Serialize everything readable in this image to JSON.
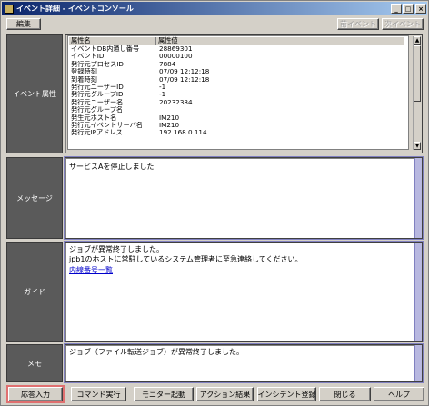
{
  "window": {
    "title": "イベント詳細 - イベントコンソール"
  },
  "toolbar": {
    "edit": "編集",
    "prev_event": "前イベント",
    "next_event": "次イベント"
  },
  "sections": {
    "attributes_label": "イベント属性",
    "message_label": "メッセージ",
    "guide_label": "ガイド",
    "memo_label": "メモ"
  },
  "attributes": {
    "col_name": "属性名",
    "col_value": "属性値",
    "rows": [
      {
        "name": "イベントDB内通し番号",
        "value": "28869301"
      },
      {
        "name": "イベントID",
        "value": "00000100"
      },
      {
        "name": "発行元プロセスID",
        "value": "7884"
      },
      {
        "name": "登録時刻",
        "value": "07/09 12:12:18"
      },
      {
        "name": "到着時刻",
        "value": "07/09 12:12:18"
      },
      {
        "name": "発行元ユーザーID",
        "value": "-1"
      },
      {
        "name": "発行元グループID",
        "value": "-1"
      },
      {
        "name": "発行元ユーザー名",
        "value": "20232384"
      },
      {
        "name": "発行元グループ名",
        "value": ""
      },
      {
        "name": "発生元ホスト名",
        "value": "IM210"
      },
      {
        "name": "発行元イベントサーバ名",
        "value": "IM210"
      },
      {
        "name": "発行元IPアドレス",
        "value": "192.168.0.114"
      }
    ]
  },
  "message": "サービスAを停止しました",
  "guide": {
    "line1": "ジョブが異常終了しました。",
    "line2": "jpb1のホストに常駐しているシステム管理者に至急連絡してください。",
    "link": "内線番号一覧"
  },
  "memo": "ジョブ（ファイル転送ジョブ）が異常終了しました。",
  "buttons": {
    "response": "応答入力",
    "command": "コマンド実行",
    "monitor": "モニター起動",
    "action": "アクション結果",
    "incident": "インシデント登録",
    "close": "閉じる",
    "help": "ヘルプ"
  }
}
